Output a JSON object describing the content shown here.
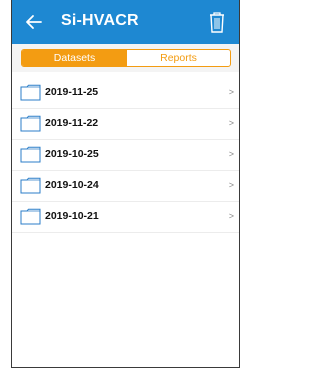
{
  "header": {
    "title": "Si-HVACR",
    "back_icon": "back-arrow-icon",
    "delete_icon": "trash-icon",
    "color": "#1e88d2"
  },
  "segments": {
    "active": "Datasets",
    "inactive": "Reports",
    "accent": "#f39c12"
  },
  "folders": [
    {
      "name": "2019-11-25",
      "chevron": ">"
    },
    {
      "name": "2019-11-22",
      "chevron": ">"
    },
    {
      "name": "2019-10-25",
      "chevron": ">"
    },
    {
      "name": "2019-10-24",
      "chevron": ">"
    },
    {
      "name": "2019-10-21",
      "chevron": ">"
    }
  ]
}
